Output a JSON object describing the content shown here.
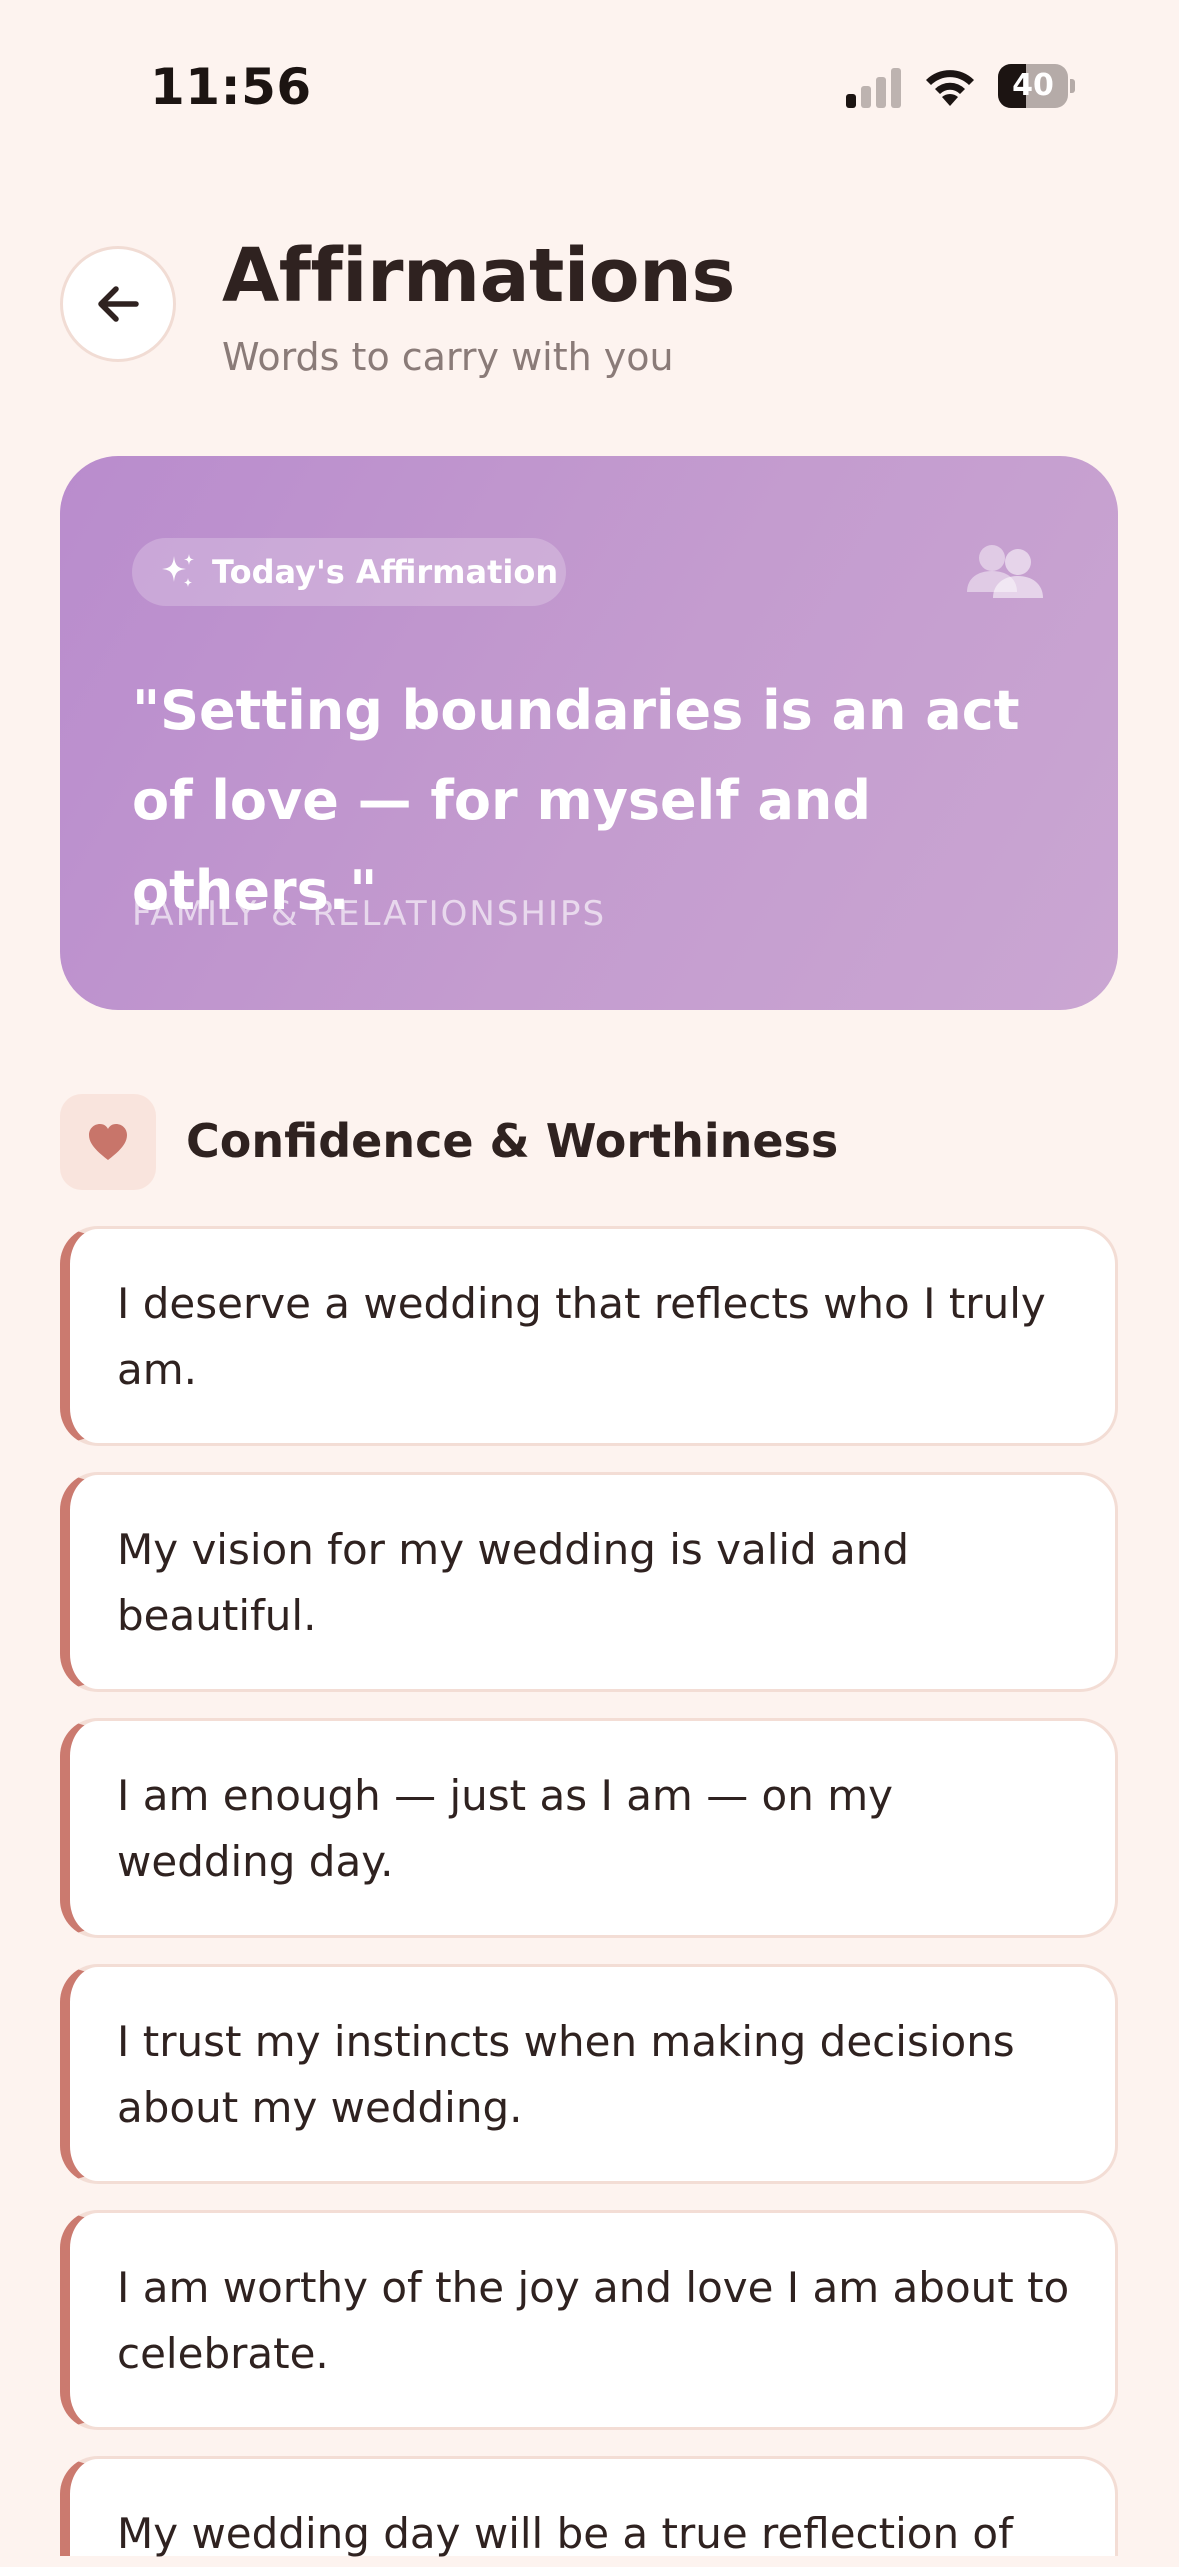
{
  "status_bar": {
    "time": "11:56",
    "battery": "40",
    "battery_level": 0.4
  },
  "header": {
    "title": "Affirmations",
    "subtitle": "Words to carry with you"
  },
  "featured": {
    "badge_label": "Today's Affirmation",
    "quote": "\"Setting boundaries is an act of love — for myself and others.\"",
    "category": "FAMILY & RELATIONSHIPS"
  },
  "section": {
    "title": "Confidence & Worthiness"
  },
  "affirmations": [
    "I deserve a wedding that reflects who I truly am.",
    "My vision for my wedding is valid and beautiful.",
    "I am enough — just as I am — on my wedding day.",
    "I trust my instincts when making decisions about my wedding.",
    "I am worthy of the joy and love I am about to celebrate.",
    "My wedding day will be a true reflection of"
  ],
  "colors": {
    "background": "#fdf3ef",
    "accent": "#cb7a6f",
    "featured_card": "#c49ccf",
    "text": "#2f2220"
  }
}
